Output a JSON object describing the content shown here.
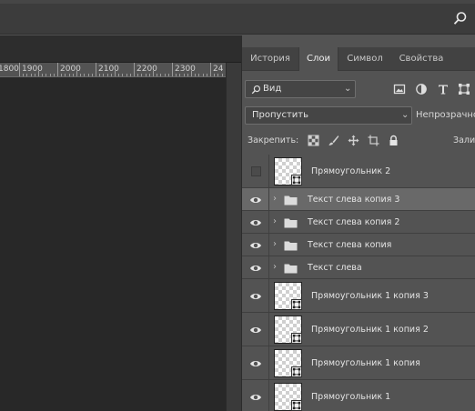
{
  "ruler": {
    "ticks": [
      "1800",
      "1900",
      "2000",
      "2100",
      "2200",
      "2300",
      "24"
    ]
  },
  "tabs": [
    {
      "label": "История",
      "active": false
    },
    {
      "label": "Слои",
      "active": true
    },
    {
      "label": "Символ",
      "active": false
    },
    {
      "label": "Свойства",
      "active": false
    }
  ],
  "filter": {
    "kind_label": "Вид",
    "search_icon": "search-icon"
  },
  "filter_icons": [
    "image-filter-icon",
    "adjustment-filter-icon",
    "type-filter-icon",
    "shape-filter-icon"
  ],
  "blend": {
    "mode": "Пропустить",
    "opacity_label": "Непрозрачно"
  },
  "lock": {
    "label": "Закрепить:",
    "fill_label": "Зали"
  },
  "layers": [
    {
      "name": "Прямоугольник 2",
      "kind": "shape",
      "visible": false,
      "selected": false
    },
    {
      "name": "Текст слева копия 3",
      "kind": "group",
      "visible": true,
      "selected": true
    },
    {
      "name": "Текст слева копия 2",
      "kind": "group",
      "visible": true,
      "selected": false
    },
    {
      "name": "Текст слева копия",
      "kind": "group",
      "visible": true,
      "selected": false
    },
    {
      "name": "Текст слева",
      "kind": "group",
      "visible": true,
      "selected": false
    },
    {
      "name": "Прямоугольник 1 копия 3",
      "kind": "shape",
      "visible": true,
      "selected": false
    },
    {
      "name": "Прямоугольник 1 копия 2",
      "kind": "shape",
      "visible": true,
      "selected": false
    },
    {
      "name": "Прямоугольник 1 копия",
      "kind": "shape",
      "visible": true,
      "selected": false
    },
    {
      "name": "Прямоугольник 1",
      "kind": "shape",
      "visible": true,
      "selected": false
    }
  ]
}
